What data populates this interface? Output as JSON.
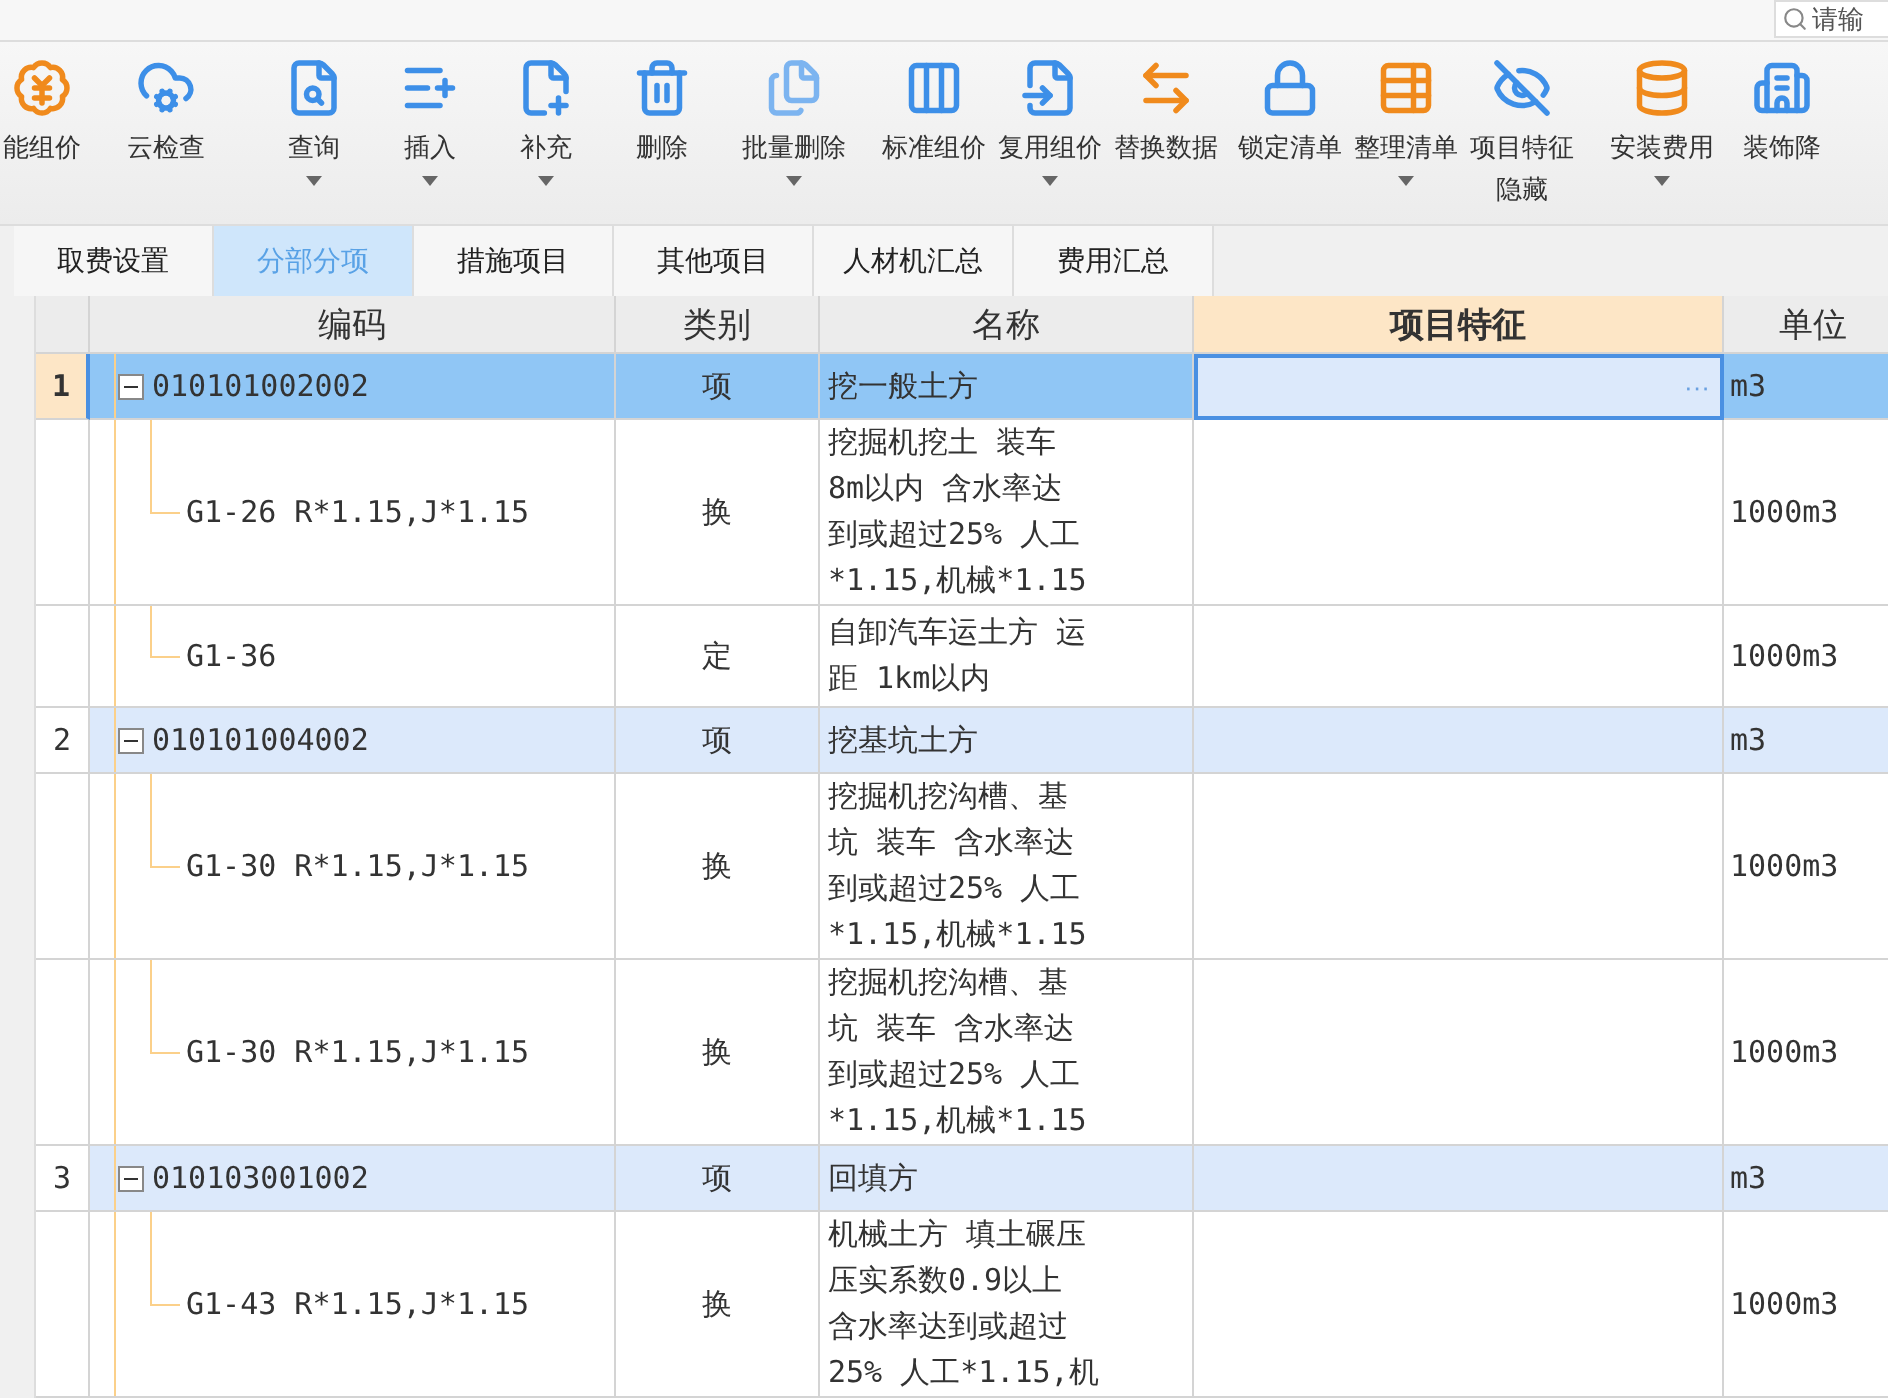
{
  "search": {
    "placeholder": "请输"
  },
  "toolbar": [
    {
      "label": "能组价",
      "dropdown": false
    },
    {
      "label": "云检查",
      "dropdown": false
    },
    {
      "label": "查询",
      "dropdown": true
    },
    {
      "label": "插入",
      "dropdown": true
    },
    {
      "label": "补充",
      "dropdown": true
    },
    {
      "label": "删除",
      "dropdown": false
    },
    {
      "label": "批量删除",
      "dropdown": true
    },
    {
      "label": "标准组价",
      "dropdown": false
    },
    {
      "label": "复用组价",
      "dropdown": true
    },
    {
      "label": "替换数据",
      "dropdown": false
    },
    {
      "label": "锁定清单",
      "dropdown": false
    },
    {
      "label": "整理清单",
      "dropdown": true
    },
    {
      "label": "项目特征隐藏",
      "dropdown": false
    },
    {
      "label": "安装费用",
      "dropdown": true
    },
    {
      "label": "装饰降",
      "dropdown": false
    }
  ],
  "tabs": [
    {
      "label": "取费设置",
      "selected": false
    },
    {
      "label": "分部分项",
      "selected": true
    },
    {
      "label": "措施项目",
      "selected": false
    },
    {
      "label": "其他项目",
      "selected": false
    },
    {
      "label": "人材机汇总",
      "selected": false
    },
    {
      "label": "费用汇总",
      "selected": false
    }
  ],
  "table": {
    "columns": [
      {
        "label": "编码",
        "active": false
      },
      {
        "label": "类别",
        "active": false
      },
      {
        "label": "名称",
        "active": false
      },
      {
        "label": "项目特征",
        "active": true
      },
      {
        "label": "单位",
        "active": false
      }
    ],
    "rows": [
      {
        "kind": "item",
        "number": "1",
        "expanded": true,
        "selected": true,
        "code": "010101002002",
        "type": "项",
        "name": [
          "挖一般土方"
        ],
        "feature_button": "···",
        "unit": "m3"
      },
      {
        "kind": "sub",
        "code": "G1-26 R*1.15,J*1.15",
        "type": "换",
        "name": [
          "挖掘机挖土 装车",
          "8m以内  含水率达",
          "到或超过25% 人工",
          "*1.15,机械*1.15"
        ],
        "unit": "1000m3"
      },
      {
        "kind": "sub",
        "code": "G1-36",
        "type": "定",
        "name": [
          "自卸汽车运土方 运",
          "距 1km以内"
        ],
        "unit": "1000m3"
      },
      {
        "kind": "item",
        "number": "2",
        "expanded": true,
        "selected": false,
        "code": "010101004002",
        "type": "项",
        "name": [
          "挖基坑土方"
        ],
        "unit": "m3"
      },
      {
        "kind": "sub",
        "code": "G1-30 R*1.15,J*1.15",
        "type": "换",
        "name": [
          "挖掘机挖沟槽、基",
          "坑 装车  含水率达",
          "到或超过25% 人工",
          "*1.15,机械*1.15"
        ],
        "unit": "1000m3"
      },
      {
        "kind": "sub",
        "code": "G1-30 R*1.15,J*1.15",
        "type": "换",
        "name": [
          "挖掘机挖沟槽、基",
          "坑 装车  含水率达",
          "到或超过25% 人工",
          "*1.15,机械*1.15"
        ],
        "unit": "1000m3"
      },
      {
        "kind": "item",
        "number": "3",
        "expanded": true,
        "selected": false,
        "code": "010103001002",
        "type": "项",
        "name": [
          "回填方"
        ],
        "unit": "m3"
      },
      {
        "kind": "sub",
        "code": "G1-43 R*1.15,J*1.15",
        "type": "换",
        "name": [
          "机械土方 填土碾压",
          "压实系数0.9以上",
          "含水率达到或超过",
          "25% 人工*1.15,机"
        ],
        "unit": "1000m3"
      }
    ]
  }
}
